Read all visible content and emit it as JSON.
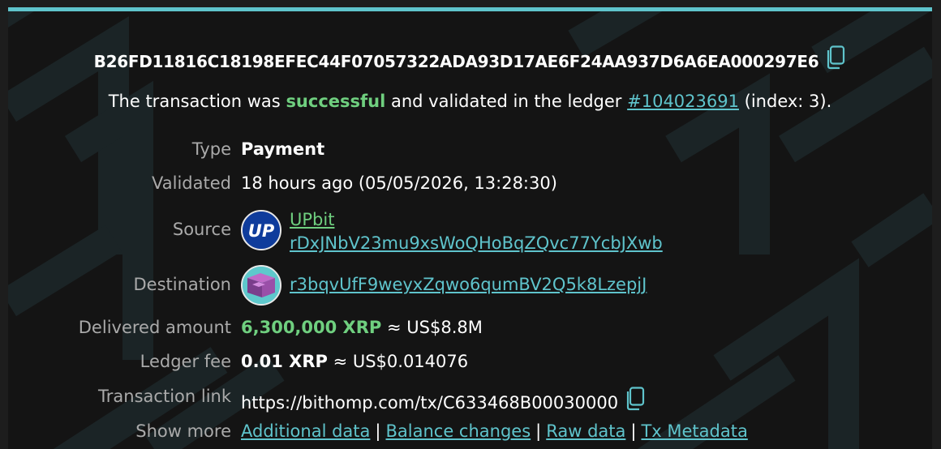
{
  "tx": {
    "hash": "B26FD11816C18198EFEC44F07057322ADA93D17AE6F24AA937D6A6EA000297E6",
    "status_prefix": "The transaction was",
    "status_word": "successful",
    "status_middle": "and validated in the ledger",
    "ledger_link": "#104023691",
    "index_text": "(index: 3)."
  },
  "details": {
    "type_label": "Type",
    "type_value": "Payment",
    "validated_label": "Validated",
    "validated_value": "18 hours ago (05/05/2026, 13:28:30)",
    "source_label": "Source",
    "source_name": "UPbit",
    "source_address": "rDxJNbV23mu9xsWoQHoBqZQvc77YcbJXwb",
    "source_avatar_text": "UP",
    "destination_label": "Destination",
    "destination_address": "r3bqvUfF9weyxZqwo6qumBV2Q5k8LzepjJ",
    "delivered_label": "Delivered amount",
    "delivered_amount": "6,300,000 XRP",
    "delivered_fiat": "≈ US$8.8M",
    "fee_label": "Ledger fee",
    "fee_amount": "0.01 XRP",
    "fee_fiat": "≈ US$0.014076",
    "txlink_label": "Transaction link",
    "txlink_value": "https://bithomp.com/tx/C633468B00030000",
    "showmore_label": "Show more",
    "showmore_links": [
      "Additional data",
      "Balance changes",
      "Raw data",
      "Tx Metadata"
    ],
    "showmore_separator": "|"
  },
  "colors": {
    "accent": "#5fc4cc",
    "success": "#6fcf7f",
    "background": "#141414",
    "label": "#aaaaaa"
  },
  "icons": {
    "copy": "copy-icon",
    "source_avatar": "upbit-logo-icon",
    "destination_avatar": "identicon-icon"
  }
}
